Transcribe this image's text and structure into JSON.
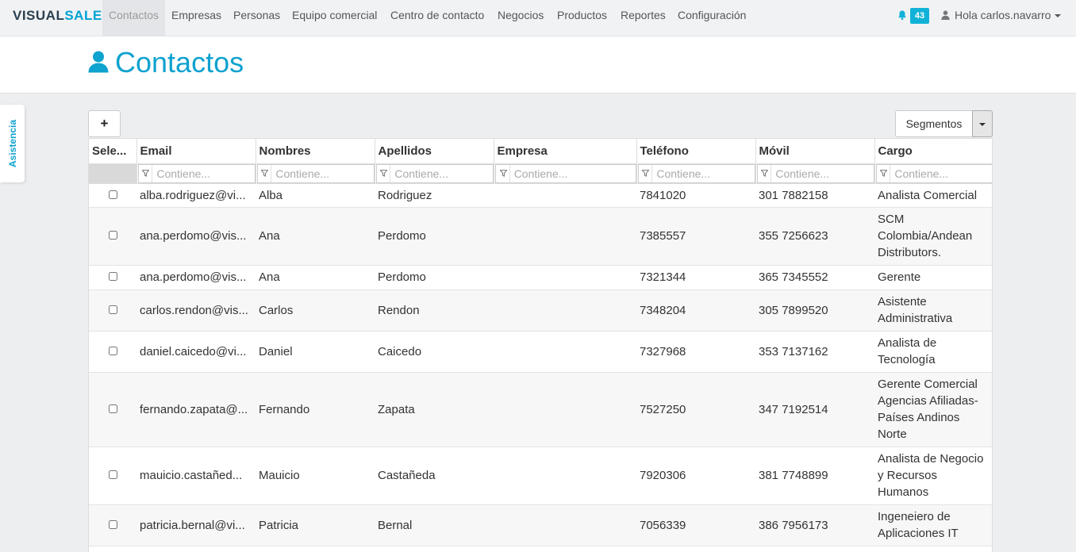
{
  "app": {
    "logo_part1": "VISUAL",
    "logo_part2": "SALE"
  },
  "nav": {
    "items": [
      "Contactos",
      "Empresas",
      "Personas",
      "Equipo comercial",
      "Centro de contacto",
      "Negocios",
      "Productos",
      "Reportes",
      "Configuración"
    ],
    "active_index": 0,
    "notifications": "43",
    "user_label": "Hola carlos.navarro"
  },
  "header": {
    "title": "Contactos"
  },
  "side_tab": {
    "label": "Asistencia"
  },
  "toolbar": {
    "add_label": "+",
    "segments_label": "Segmentos"
  },
  "grid": {
    "columns": [
      "Sele...",
      "Email",
      "Nombres",
      "Apellidos",
      "Empresa",
      "Teléfono",
      "Móvil",
      "Cargo"
    ],
    "filter_placeholder": "Contiene...",
    "rows": [
      {
        "email": "alba.rodriguez@vi...",
        "nombres": "Alba",
        "apellidos": "Rodriguez",
        "empresa": "",
        "telefono": "7841020",
        "movil": "301 7882158",
        "cargo": "Analista Comercial"
      },
      {
        "email": "ana.perdomo@vis...",
        "nombres": "Ana",
        "apellidos": "Perdomo",
        "empresa": "",
        "telefono": "7385557",
        "movil": "355 7256623",
        "cargo": "SCM Colombia/Andean Distributors."
      },
      {
        "email": "ana.perdomo@vis...",
        "nombres": "Ana",
        "apellidos": "Perdomo",
        "empresa": "",
        "telefono": "7321344",
        "movil": "365 7345552",
        "cargo": "Gerente"
      },
      {
        "email": "carlos.rendon@vis...",
        "nombres": "Carlos",
        "apellidos": "Rendon",
        "empresa": "",
        "telefono": "7348204",
        "movil": "305 7899520",
        "cargo": "Asistente Administrativa"
      },
      {
        "email": "daniel.caicedo@vi...",
        "nombres": "Daniel",
        "apellidos": "Caicedo",
        "empresa": "",
        "telefono": "7327968",
        "movil": "353 7137162",
        "cargo": "Analista de Tecnología"
      },
      {
        "email": "fernando.zapata@...",
        "nombres": "Fernando",
        "apellidos": "Zapata",
        "empresa": "",
        "telefono": "7527250",
        "movil": "347 7192514",
        "cargo": "Gerente Comercial Agencias Afiliadas-Países Andinos Norte"
      },
      {
        "email": "mauicio.castañed...",
        "nombres": "Mauicio",
        "apellidos": "Castañeda",
        "empresa": "",
        "telefono": "7920306",
        "movil": "381 7748899",
        "cargo": "Analista de Negocio y Recursos Humanos"
      },
      {
        "email": "patricia.bernal@vi...",
        "nombres": "Patricia",
        "apellidos": "Bernal",
        "empresa": "",
        "telefono": "7056339",
        "movil": "386 7956173",
        "cargo": "Ingeneiero de Aplicaciones IT"
      }
    ]
  },
  "colors": {
    "accent": "#0ea2cf",
    "link": "#2b8ac6",
    "badge": "#12b2d8",
    "logo_dark": "#2a3f4f"
  }
}
